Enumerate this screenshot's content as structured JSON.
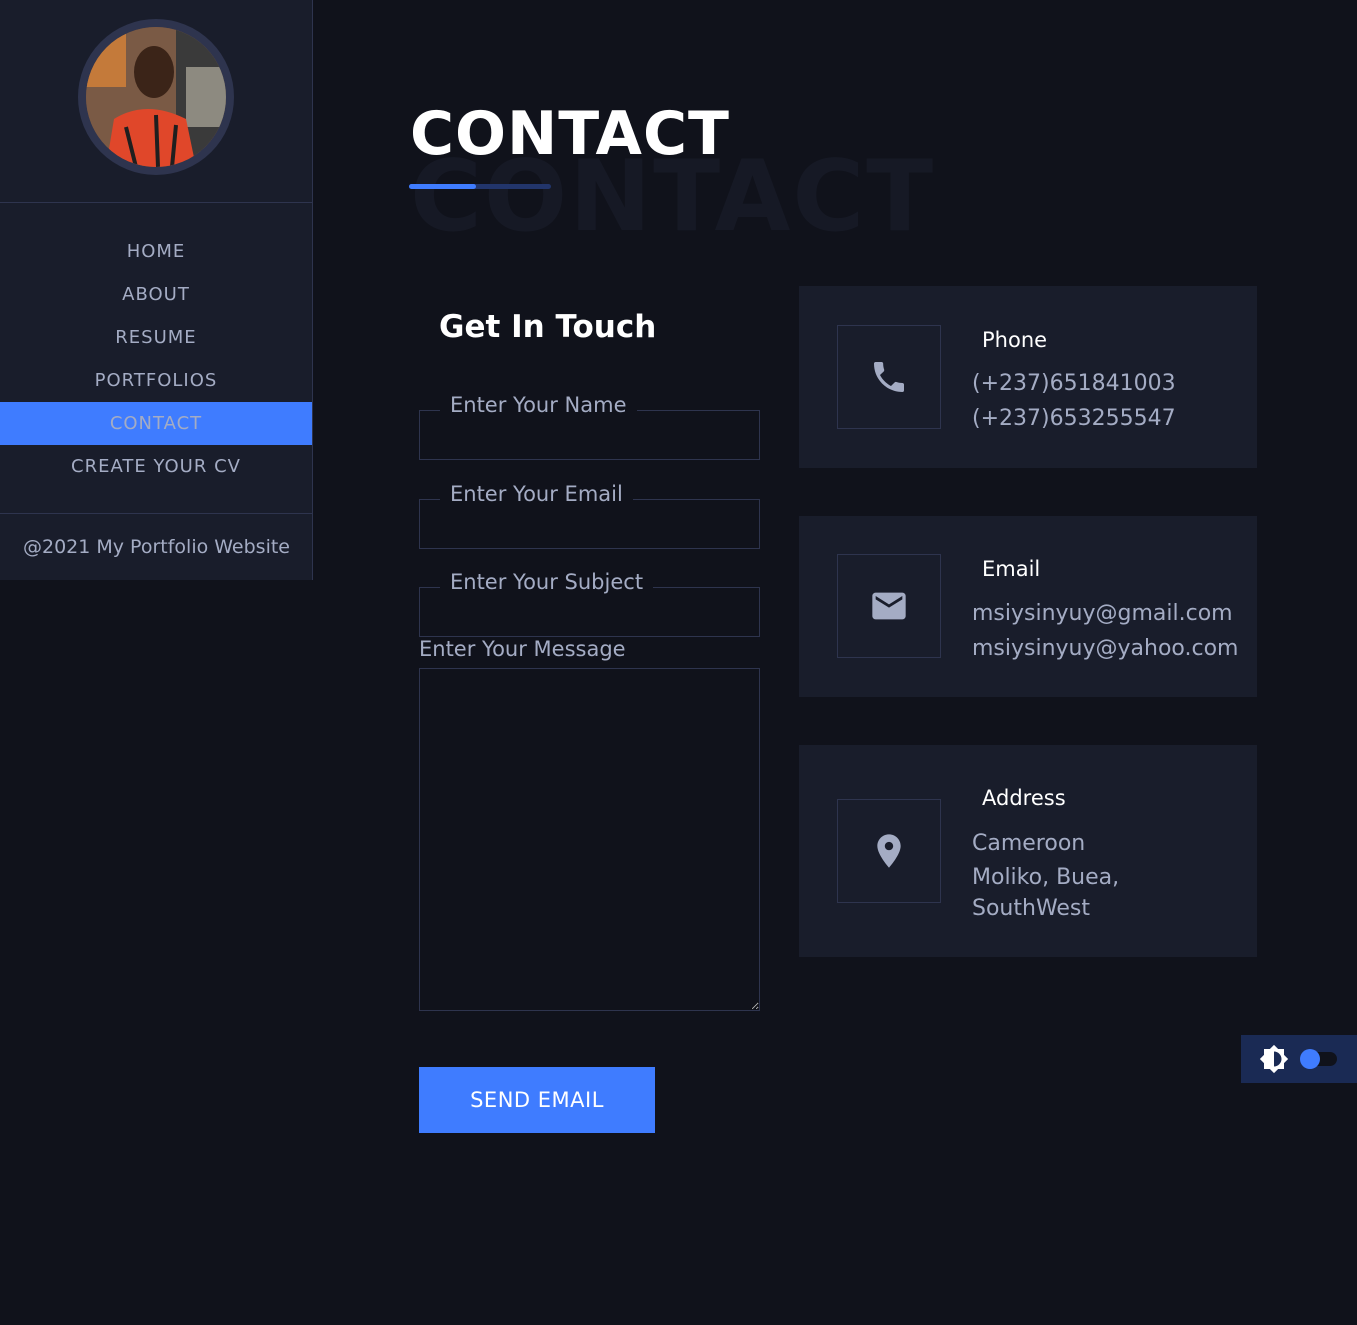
{
  "sidebar": {
    "nav": [
      {
        "label": "Home"
      },
      {
        "label": "About"
      },
      {
        "label": "Resume"
      },
      {
        "label": "Portfolios"
      },
      {
        "label": "Contact"
      },
      {
        "label": "Create Your CV"
      }
    ],
    "active_item": "Contact",
    "footer": "@2021 My Portfolio Website"
  },
  "page": {
    "title": "CONTACT",
    "title_ghost": "CONTACT"
  },
  "form": {
    "heading": "Get In Touch",
    "name_label": "Enter Your Name",
    "email_label": "Enter Your Email",
    "subject_label": "Enter Your Subject",
    "message_label": "Enter Your Message",
    "send_label": "SEND EMAIL"
  },
  "cards": {
    "phone": {
      "title": "Phone",
      "lines": [
        "(+237)651841003",
        "(+237)653255547"
      ],
      "icon": "phone-icon"
    },
    "email": {
      "title": "Email",
      "lines": [
        "msiysinyuy@gmail.com",
        "msiysinyuy@yahoo.com"
      ],
      "icon": "envelope-icon"
    },
    "address": {
      "title": "Address",
      "lines": [
        "Cameroon",
        "Moliko, Buea,",
        "SouthWest"
      ],
      "icon": "map-pin-icon"
    }
  },
  "theme_toggle": {
    "icon": "brightness-icon",
    "dark_mode": true
  },
  "colors": {
    "accent": "#3f7cff",
    "background": "#10121b",
    "panel": "#191d2b",
    "border": "#2e344e",
    "text": "#a4acc4",
    "heading": "#ffffff"
  }
}
